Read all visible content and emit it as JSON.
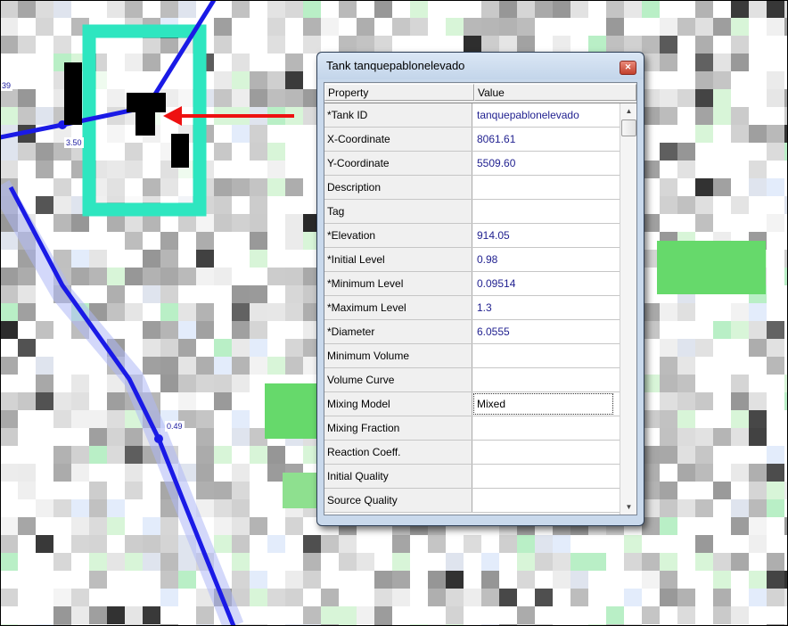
{
  "map": {
    "pipe_labels": [
      "3.50",
      "0.49"
    ],
    "edge_label": "39"
  },
  "dialog": {
    "title": "Tank tanquepablonelevado",
    "close_glyph": "✕",
    "columns": {
      "property": "Property",
      "value": "Value"
    },
    "rows": [
      {
        "property": "*Tank ID",
        "value": "tanquepablonelevado"
      },
      {
        "property": "X-Coordinate",
        "value": "8061.61"
      },
      {
        "property": "Y-Coordinate",
        "value": "5509.60"
      },
      {
        "property": "Description",
        "value": ""
      },
      {
        "property": "Tag",
        "value": ""
      },
      {
        "property": "*Elevation",
        "value": "914.05"
      },
      {
        "property": "*Initial Level",
        "value": "0.98"
      },
      {
        "property": "*Minimum Level",
        "value": "0.09514"
      },
      {
        "property": "*Maximum Level",
        "value": "1.3"
      },
      {
        "property": "*Diameter",
        "value": "6.0555"
      },
      {
        "property": "Minimum Volume",
        "value": ""
      },
      {
        "property": "Volume Curve",
        "value": ""
      },
      {
        "property": "Mixing Model",
        "value": "Mixed",
        "selected": true
      },
      {
        "property": "Mixing Fraction",
        "value": ""
      },
      {
        "property": "Reaction Coeff.",
        "value": ""
      },
      {
        "property": "Initial Quality",
        "value": ""
      },
      {
        "property": "Source Quality",
        "value": ""
      }
    ],
    "scroll_up_glyph": "▲",
    "scroll_down_glyph": "▼"
  },
  "colors": {
    "pipe": "#1a1ae6",
    "highlight": "#2ee6c0",
    "arrow": "#ee1111",
    "tank": "#000000"
  }
}
